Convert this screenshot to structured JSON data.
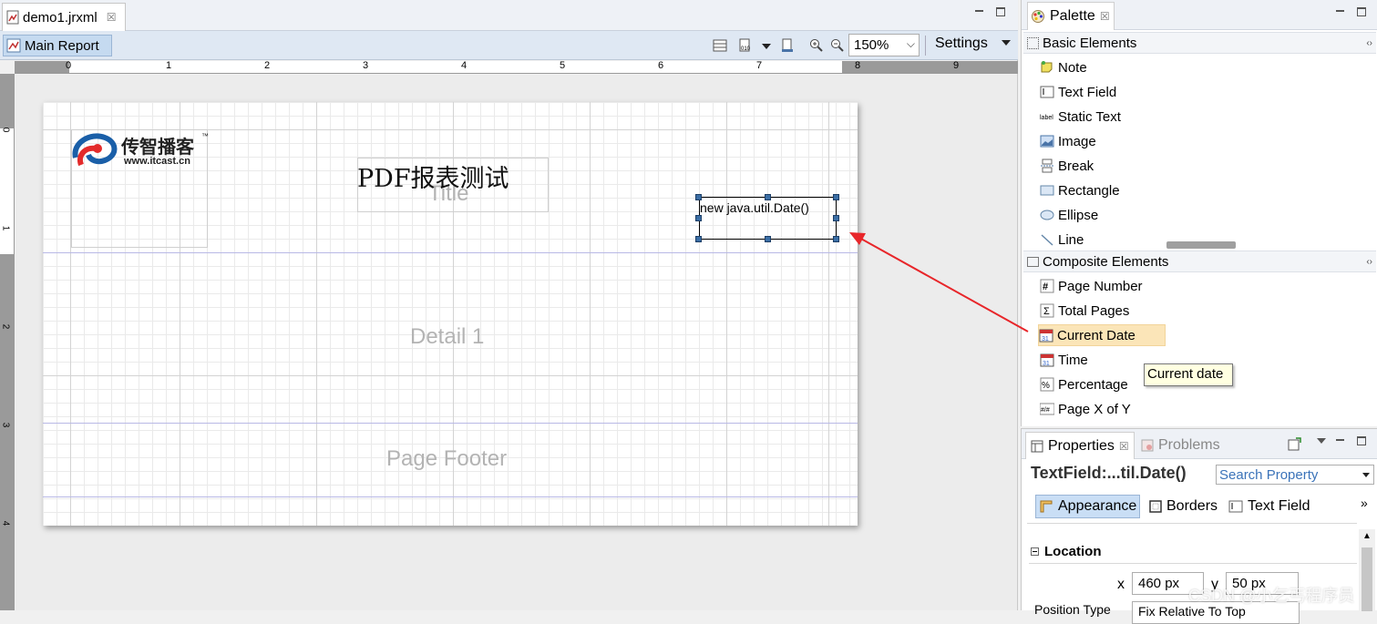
{
  "editor": {
    "tab_label": "demo1.jrxml",
    "tab_close": "☒",
    "main_report_label": "Main Report",
    "zoom_value": "150%",
    "settings_label": "Settings",
    "ruler_numbers": [
      "0",
      "1",
      "2",
      "3",
      "4",
      "5",
      "6",
      "7",
      "8",
      "9"
    ],
    "vruler_numbers": [
      "0",
      "1",
      "2",
      "3",
      "4"
    ]
  },
  "report": {
    "title_text": "PDF报表测试",
    "title_band_label": "Title",
    "detail_band_label": "Detail 1",
    "footer_band_label": "Page Footer",
    "date_field_expr": "new java.util.Date()",
    "logo_cn": "传智播客",
    "logo_tm": "™",
    "logo_url": "www.itcast.cn"
  },
  "palette": {
    "title": "Palette",
    "basic_group": "Basic Elements",
    "basic_items": [
      "Note",
      "Text Field",
      "Static Text",
      "Image",
      "Break",
      "Rectangle",
      "Ellipse",
      "Line"
    ],
    "composite_group": "Composite Elements",
    "composite_items": [
      "Page Number",
      "Total Pages",
      "Current Date",
      "Time",
      "Percentage",
      "Page X of Y"
    ],
    "tooltip": "Current date"
  },
  "properties": {
    "tab_properties": "Properties",
    "tab_problems": "Problems",
    "selection_title": "TextField:...til.Date()",
    "search_placeholder": "Search Property",
    "subtabs": [
      "Appearance",
      "Borders",
      "Text Field"
    ],
    "section_location": "Location",
    "x_label": "x",
    "x_value": "460 px",
    "y_label": "y",
    "y_value": "50 px",
    "position_type_label": "Position Type",
    "position_type_value": "Fix Relative To Top"
  },
  "watermark": "CSDN @小乞丐程序员",
  "colors": {
    "selection_handle": "#3b6ea5",
    "arrow": "#e8262a",
    "highlight": "#fbe5b8",
    "tooltip_bg": "#ffffe1"
  }
}
